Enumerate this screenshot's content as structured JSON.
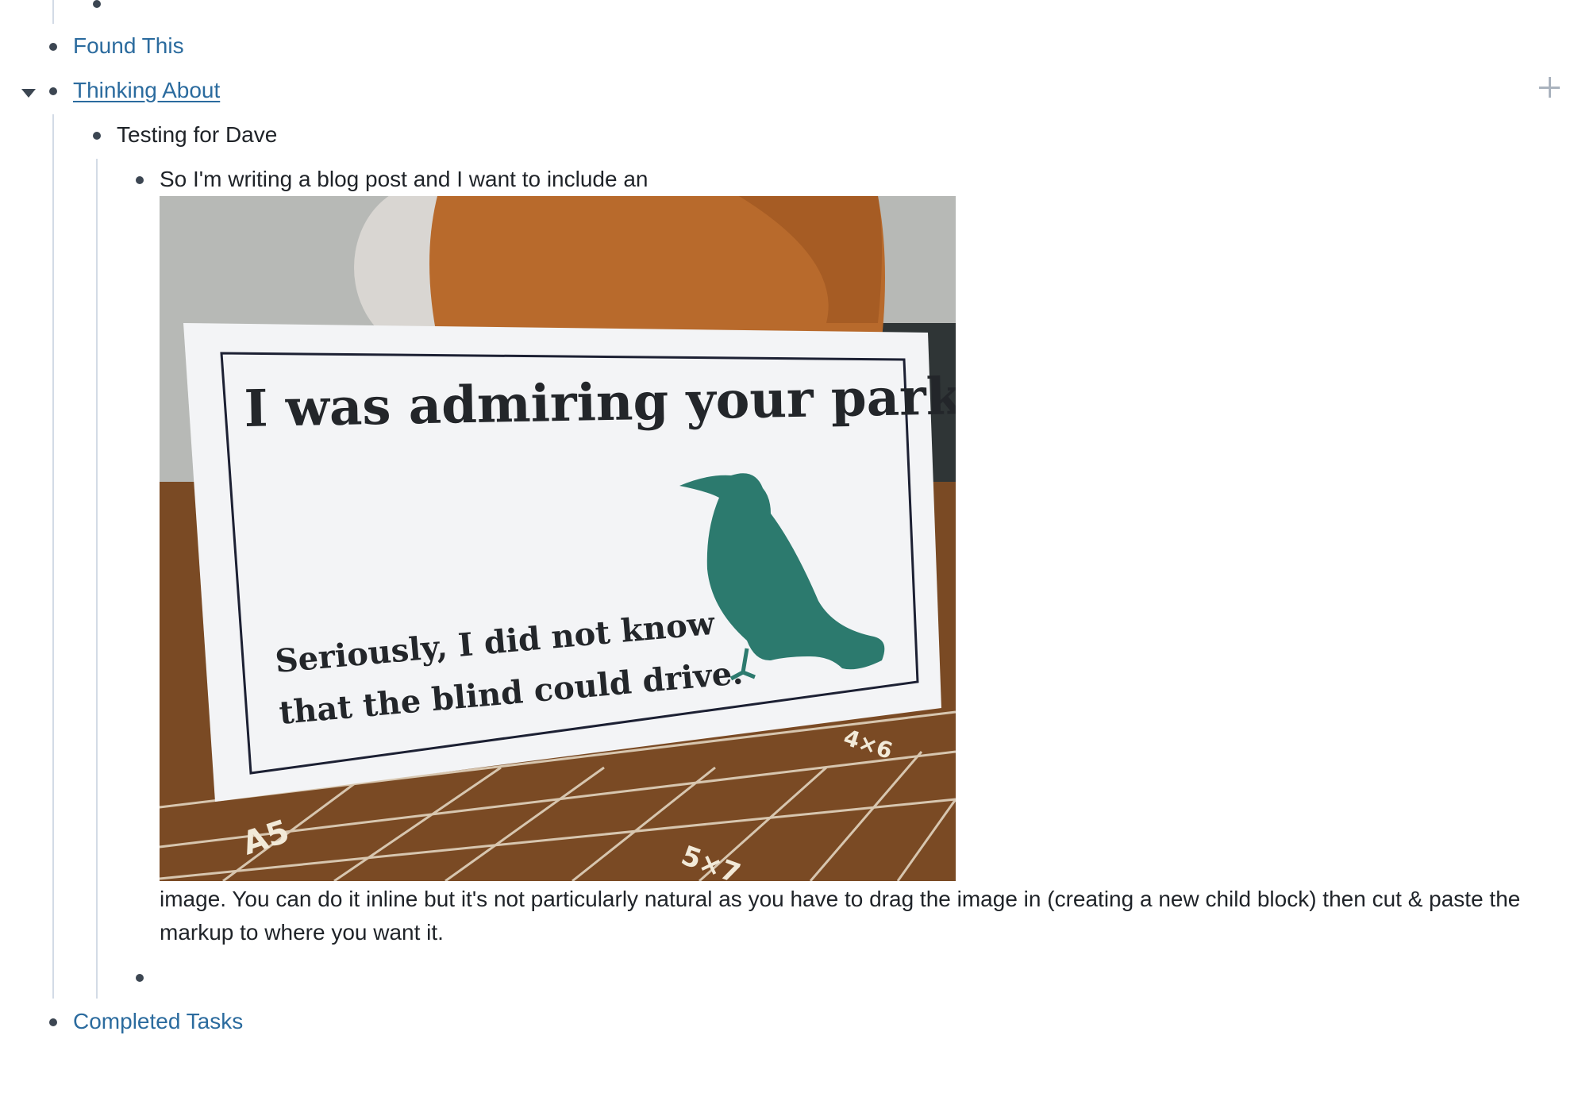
{
  "outline": {
    "found_this": "Found This",
    "thinking_about": "Thinking About",
    "testing_for_dave": "Testing for Dave",
    "note_line_1": "So I'm writing a blog post and I want to include an",
    "note_line_2": " image. You can do it inline but it's not particularly natural as you have to drag the image in (creating a new child block) then cut & paste the markup to where you want it.",
    "completed_tasks": "Completed Tasks"
  },
  "embedded_image": {
    "headline": "I was admiring your parking.",
    "subline_1": "Seriously, I did not know",
    "subline_2": "that the blind could drive.",
    "mat_label_a": "A5",
    "mat_label_b": "4×6",
    "mat_label_c": "5×7"
  },
  "icons": {
    "collapse": "caret-down-icon",
    "add": "plus-icon"
  },
  "colors": {
    "link": "#2b6b9e",
    "bullet": "#3c4652",
    "guide_line": "#d3dbe6",
    "crow": "#2c7a6e"
  }
}
